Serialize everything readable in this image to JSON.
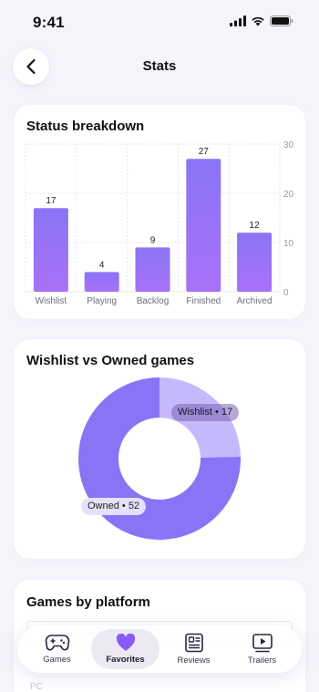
{
  "status_bar": {
    "time": "9:41"
  },
  "header": {
    "title": "Stats"
  },
  "status_breakdown": {
    "title": "Status breakdown",
    "chart_data": {
      "type": "bar",
      "categories": [
        "Wishlist",
        "Playing",
        "Backlog",
        "Finished",
        "Archived"
      ],
      "values": [
        17,
        4,
        9,
        27,
        12
      ],
      "ylim": [
        0,
        30
      ],
      "yticks": [
        0,
        10,
        20,
        30
      ],
      "bar_color_top": "#8a74f5",
      "bar_color_bottom": "#a872f8"
    }
  },
  "wishlist_owned": {
    "title": "Wishlist vs Owned games",
    "chart_data": {
      "type": "pie",
      "slices": [
        {
          "label": "Wishlist",
          "value": 17,
          "color": "#c6b9fb"
        },
        {
          "label": "Owned",
          "value": 52,
          "color": "#8a74f5"
        }
      ],
      "labels": [
        "Wishlist • 17",
        "Owned • 52"
      ]
    }
  },
  "platform": {
    "title": "Games by platform",
    "row_label": "PC"
  },
  "tabs": [
    {
      "label": "Games",
      "icon": "gamepad-icon",
      "active": false
    },
    {
      "label": "Favorites",
      "icon": "heart-icon",
      "active": true
    },
    {
      "label": "Reviews",
      "icon": "reviews-icon",
      "active": false
    },
    {
      "label": "Trailers",
      "icon": "play-icon",
      "active": false
    }
  ],
  "colors": {
    "accent": "#8a74f5",
    "background": "#f6f4fb"
  }
}
